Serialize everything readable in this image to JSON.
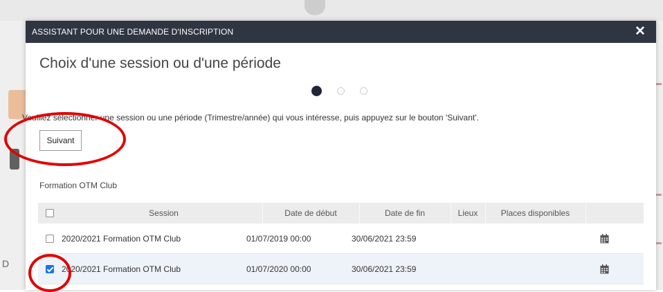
{
  "dialog": {
    "title": "ASSISTANT POUR UNE DEMANDE D'INSCRIPTION",
    "close_icon": "close-icon",
    "heading": "Choix d'une session ou d'une période",
    "wizard_steps": {
      "total": 3,
      "current": 1
    },
    "instruction": "Veuillez sélectionner une session ou une période (Trimestre/année) qui vous intéresse, puis appuyez sur le bouton 'Suivant'.",
    "next_button": "Suivant",
    "section_title": "Formation OTM Club"
  },
  "table": {
    "columns": [
      "Session",
      "Date de début",
      "Date de fin",
      "Lieux",
      "Places disponibles"
    ],
    "header_checked": false,
    "rows": [
      {
        "checked": false,
        "session": "2020/2021 Formation OTM Club",
        "start": "01/07/2019 00:00",
        "end": "30/06/2021 23:59",
        "lieux": "",
        "places": "",
        "icon": "calendar-icon"
      },
      {
        "checked": true,
        "session": "2020/2021 Formation OTM Club",
        "start": "01/07/2020 00:00",
        "end": "30/06/2021 23:59",
        "lieux": "",
        "places": "",
        "icon": "calendar-icon"
      }
    ]
  },
  "annotations": {
    "color": "#e10000"
  },
  "colors": {
    "header_bg": "#2f3541",
    "active_step": "#1e2637",
    "checkbox_checked": "#1a73e8"
  }
}
